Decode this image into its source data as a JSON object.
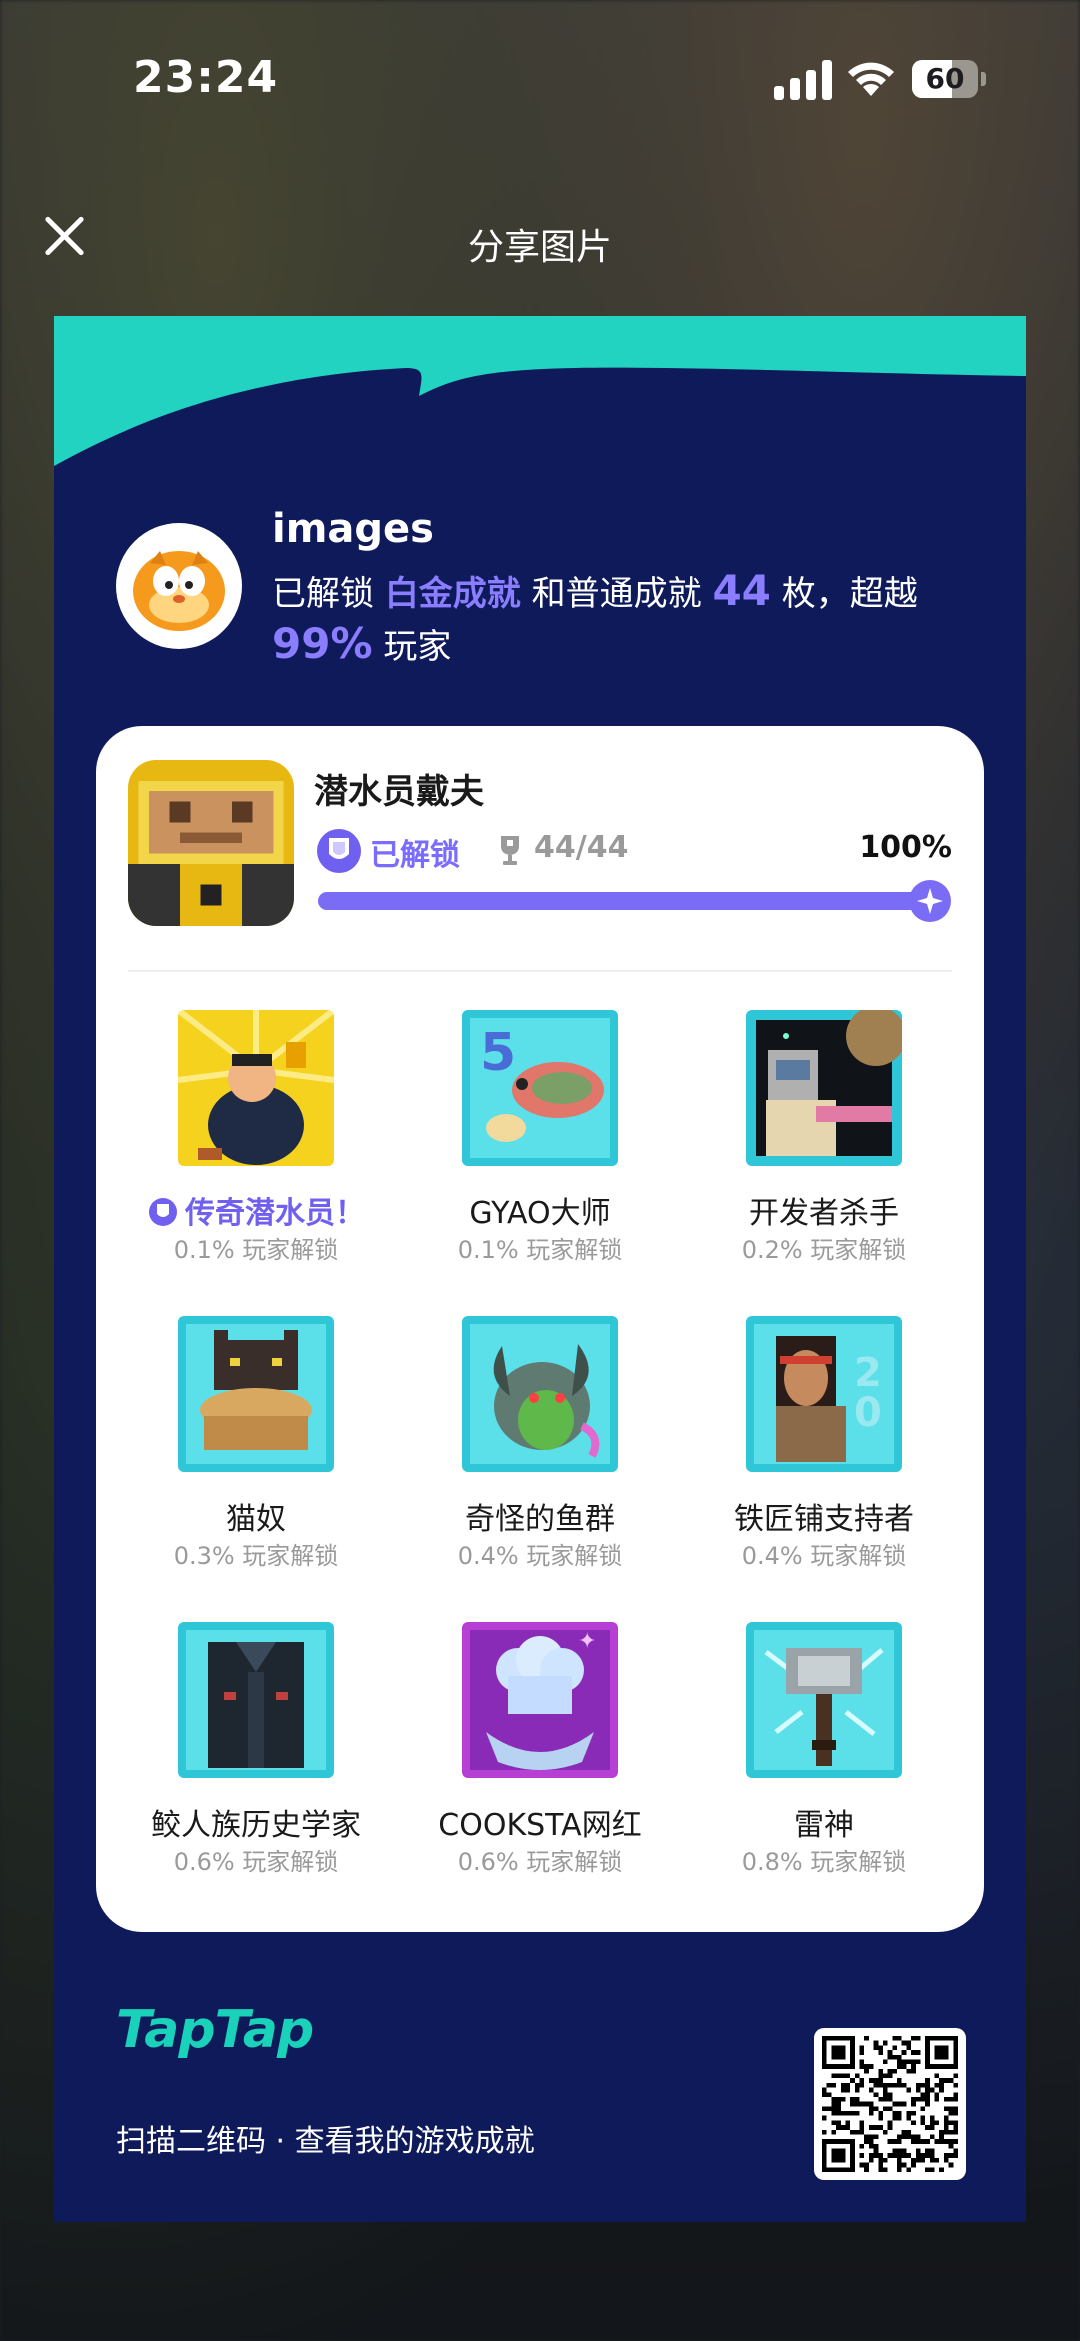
{
  "status_bar": {
    "time": "23:24",
    "battery": "60",
    "battery_level": 0.6
  },
  "header": {
    "title": "分享图片"
  },
  "profile": {
    "username": "images",
    "summary_prefix": "已解锁",
    "platinum": "白金成就",
    "summary_mid": "和普通成就",
    "count": "44",
    "summary_unit": "枚，超越",
    "beat_percent": "99%",
    "summary_suffix": "玩家"
  },
  "game": {
    "name": "潜水员戴夫",
    "status": "已解锁",
    "trophies": "44/44",
    "percent": "100%",
    "progress": 1.0
  },
  "achievements": [
    {
      "name": "传奇潜水员！",
      "rate": "0.1% 玩家解锁",
      "icon": "legend-diver-icon",
      "legendary": true
    },
    {
      "name": "GYAO大师",
      "rate": "0.1% 玩家解锁",
      "icon": "gyao-master-icon",
      "legendary": false
    },
    {
      "name": "开发者杀手",
      "rate": "0.2% 玩家解锁",
      "icon": "developer-killer-icon",
      "legendary": false
    },
    {
      "name": "猫奴",
      "rate": "0.3% 玩家解锁",
      "icon": "cat-lover-icon",
      "legendary": false
    },
    {
      "name": "奇怪的鱼群",
      "rate": "0.4% 玩家解锁",
      "icon": "strange-fish-icon",
      "legendary": false
    },
    {
      "name": "铁匠铺支持者",
      "rate": "0.4% 玩家解锁",
      "icon": "blacksmith-supporter-icon",
      "legendary": false
    },
    {
      "name": "鲛人族历史学家",
      "rate": "0.6% 玩家解锁",
      "icon": "merfolk-historian-icon",
      "legendary": false
    },
    {
      "name": "COOKSTA网红",
      "rate": "0.6% 玩家解锁",
      "icon": "cooksta-influencer-icon",
      "legendary": false
    },
    {
      "name": "雷神",
      "rate": "0.8% 玩家解锁",
      "icon": "thor-hammer-icon",
      "legendary": false
    }
  ],
  "footer": {
    "brand": "TapTap",
    "caption": "扫描二维码 · 查看我的游戏成就"
  },
  "colors": {
    "card_bg": "#0f1a5a",
    "accent": "#7b6cf5",
    "teal": "#1ad1b9"
  }
}
